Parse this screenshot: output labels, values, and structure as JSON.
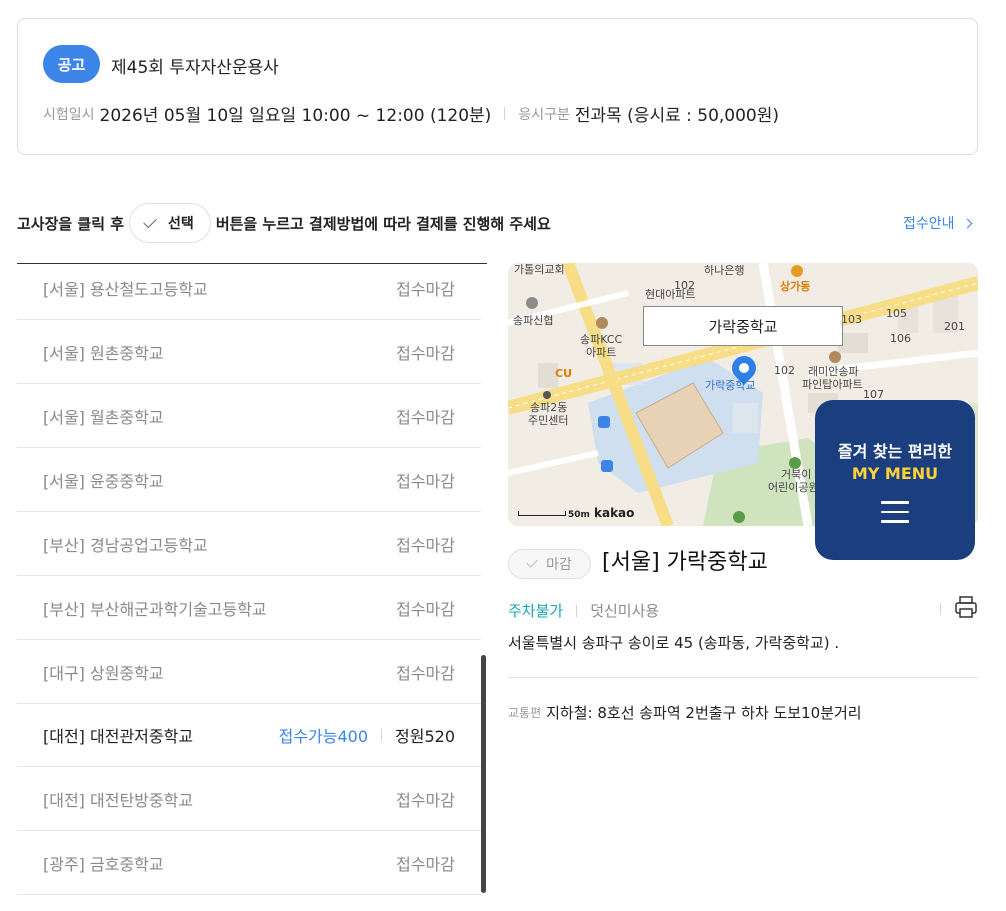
{
  "exam": {
    "badge": "공고",
    "title": "제45회 투자자산운용사",
    "date_label": "시험일시",
    "date_value": "2026년 05월 10일 일요일 10:00 ~ 12:00 (120분)",
    "type_label": "응시구분",
    "type_value": "전과목 (응시료 : 50,000원)"
  },
  "guide": {
    "text_before": "고사장을 클릭 후",
    "select_label": "선택",
    "text_after": "버튼을 누르고 결제방법에 따라 결제를 진행해 주세요",
    "apply_guide_link": "접수안내"
  },
  "venues": [
    {
      "name": "[서울] 용산철도고등학교",
      "status": "접수마감"
    },
    {
      "name": "[서울] 원촌중학교",
      "status": "접수마감"
    },
    {
      "name": "[서울] 월촌중학교",
      "status": "접수마감"
    },
    {
      "name": "[서울] 윤중중학교",
      "status": "접수마감"
    },
    {
      "name": "[부산] 경남공업고등학교",
      "status": "접수마감"
    },
    {
      "name": "[부산] 부산해군과학기술고등학교",
      "status": "접수마감"
    },
    {
      "name": "[대구] 상원중학교",
      "status": "접수마감"
    },
    {
      "name": "[대전] 대전관저중학교",
      "available": "접수가능400",
      "quota": "정원520"
    },
    {
      "name": "[대전] 대전탄방중학교",
      "status": "접수마감"
    },
    {
      "name": "[광주] 금호중학교",
      "status": "접수마감"
    }
  ],
  "map": {
    "place_label": "가락중학교",
    "pin_label": "가락중학교",
    "scale": "50m",
    "brand": "kakao",
    "labels": {
      "church": "가톨의교회",
      "hana": "하나은행",
      "hyundai": "현대아파트",
      "sanggadong": "상가동",
      "songpa_sinhyeop": "송파신협",
      "kcc": "송파KCC",
      "kcc2": "아파트",
      "songpa2": "송파2동",
      "cu": "CU",
      "center1": "송파2동",
      "center2": "주민센터",
      "raemian1": "래미안송파",
      "raemian2": "파인탑아파트",
      "geobuk1": "거북이",
      "geobuk2": "어린이공원",
      "n102a": "102",
      "n102b": "102",
      "n103": "103",
      "n105": "105",
      "n106": "106",
      "n107": "107",
      "n201": "201"
    }
  },
  "my_menu": {
    "line1": "즐겨 찾는 편리한",
    "line2": "MY MENU"
  },
  "detail": {
    "status_label": "마감",
    "title": "[서울] 가락중학교",
    "parking": "주차불가",
    "shoe_cover": "덧신미사용",
    "address": "서울특별시 송파구 송이로 45 (송파동, 가락중학교) .",
    "transit_label": "교통편",
    "transit_value": "지하철: 8호선 송파역 2번출구 하차 도보10분거리"
  },
  "colors": {
    "accent_blue": "#3c84e8",
    "parking_teal": "#1aa7b4",
    "my_menu_navy": "#1a3e7e",
    "my_menu_yellow": "#ffd23a"
  }
}
